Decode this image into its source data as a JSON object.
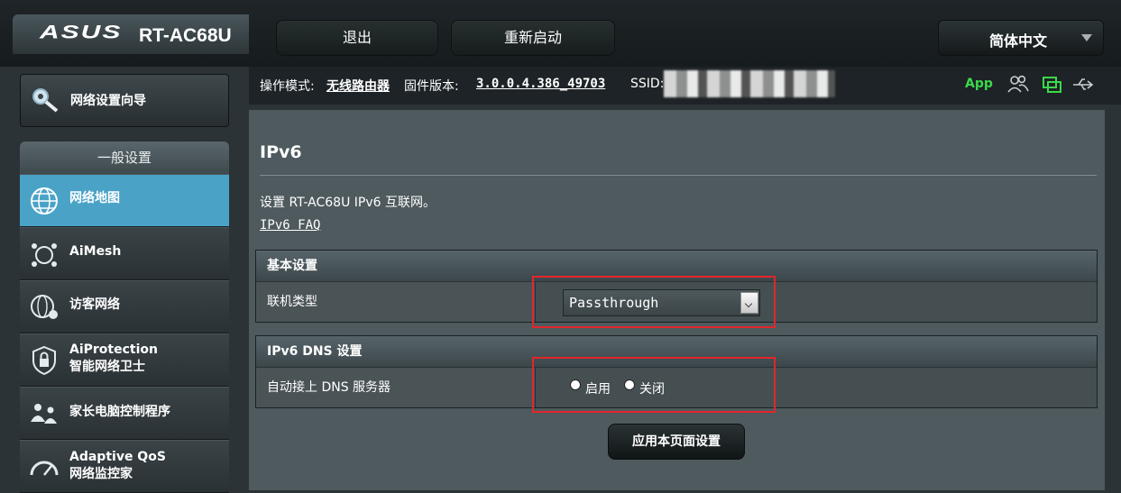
{
  "header": {
    "logo": "ASUS",
    "model": "RT-AC68U",
    "logout_label": "退出",
    "reboot_label": "重新启动",
    "language": "简体中文"
  },
  "status": {
    "mode_label": "操作模式:",
    "mode_value": "无线路由器",
    "firmware_label": "固件版本:",
    "firmware_value": "3.0.0.4.386_49703",
    "ssid_label": "SSID:",
    "app_label": "App"
  },
  "sidebar": {
    "wizard_label": "网络设置向导",
    "section_title": "一般设置",
    "items": [
      {
        "label": "网络地图",
        "icon": "globe-icon",
        "active": true
      },
      {
        "label": "AiMesh",
        "icon": "aimesh-icon",
        "active": false
      },
      {
        "label": "访客网络",
        "icon": "guest-network-icon",
        "active": false
      },
      {
        "label": "AiProtection",
        "label2": "智能网络卫士",
        "icon": "lock-shield-icon",
        "active": false
      },
      {
        "label": "家长电脑控制程序",
        "icon": "family-icon",
        "active": false
      },
      {
        "label": "Adaptive QoS",
        "label2": "网络监控家",
        "icon": "gauge-icon",
        "active": false
      }
    ]
  },
  "main": {
    "title": "IPv6",
    "description": "设置 RT-AC68U IPv6 互联网。",
    "faq_link": "IPv6 FAQ",
    "basic_section": {
      "header": "基本设置",
      "connection_label": "联机类型",
      "connection_value": "Passthrough"
    },
    "dns_section": {
      "header": "IPv6 DNS 设置",
      "auto_dns_label": "自动接上 DNS 服务器",
      "option_enable": "启用",
      "option_disable": "关闭",
      "selected": "关闭"
    },
    "apply_label": "应用本页面设置"
  },
  "colors": {
    "accent_active": "#4aa3c7",
    "highlight_box": "#e3262b",
    "app_green": "#3cd84a"
  }
}
